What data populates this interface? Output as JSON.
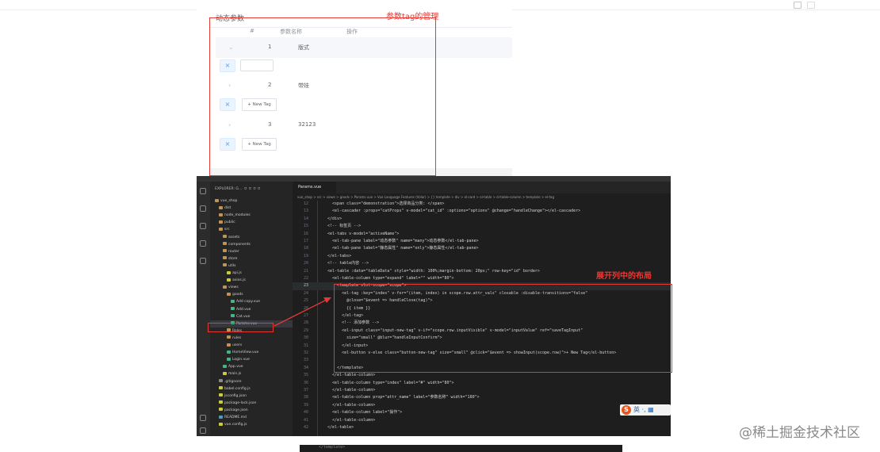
{
  "top_screenshot": {
    "title": "动态参数",
    "headers": [
      "#",
      "参数名称",
      "操作"
    ],
    "rows": [
      {
        "index": "1",
        "name": "版式",
        "expanded": true,
        "expand_icon": "chevron-down-icon"
      },
      {
        "index": "2",
        "name": "带娃",
        "expanded": false,
        "expand_icon": "chevron-right-icon"
      },
      {
        "index": "3",
        "name": "32123",
        "expanded": false,
        "expand_icon": "chevron-right-icon"
      }
    ],
    "new_tag_label": "+ New Tag",
    "tag_close": "×",
    "annotation": "参数tag的管理"
  },
  "editor": {
    "tab_label": "Params.vue",
    "explorer_title": "EXPLORER: G...",
    "breadcrumb": "vue_shop > src > views > goods > Params.vue > Vue Language Features (Volar) > {} template > div > el-card > el-table > el-table-column > template > el-tag",
    "explorer_items": [
      {
        "label": "vue_shop",
        "level": 0,
        "icon": "folder-open-icon"
      },
      {
        "label": "dist",
        "level": 1,
        "icon": "folder-icon"
      },
      {
        "label": "node_modules",
        "level": 1,
        "icon": "folder-icon"
      },
      {
        "label": "public",
        "level": 1,
        "icon": "folder-icon"
      },
      {
        "label": "src",
        "level": 1,
        "icon": "folder-open-icon"
      },
      {
        "label": "assets",
        "level": 2,
        "icon": "folder-icon"
      },
      {
        "label": "components",
        "level": 2,
        "icon": "folder-icon"
      },
      {
        "label": "router",
        "level": 2,
        "icon": "folder-icon"
      },
      {
        "label": "store",
        "level": 2,
        "icon": "folder-icon"
      },
      {
        "label": "utils",
        "level": 2,
        "icon": "folder-open-icon"
      },
      {
        "label": "api.js",
        "level": 3,
        "icon": "js-file-icon"
      },
      {
        "label": "axios.js",
        "level": 3,
        "icon": "js-file-icon"
      },
      {
        "label": "views",
        "level": 2,
        "icon": "folder-open-icon"
      },
      {
        "label": "goods",
        "level": 3,
        "icon": "folder-open-icon"
      },
      {
        "label": "Add copy.vue",
        "level": 4,
        "icon": "vue-file-icon"
      },
      {
        "label": "Add.vue",
        "level": 4,
        "icon": "vue-file-icon"
      },
      {
        "label": "Cat.vue",
        "level": 4,
        "icon": "vue-file-icon"
      },
      {
        "label": "Params.vue",
        "level": 4,
        "icon": "vue-file-icon",
        "selected": true
      },
      {
        "label": "Roles",
        "level": 3,
        "icon": "folder-icon"
      },
      {
        "label": "rules",
        "level": 3,
        "icon": "folder-icon"
      },
      {
        "label": "users",
        "level": 3,
        "icon": "folder-icon"
      },
      {
        "label": "HomeView.vue",
        "level": 3,
        "icon": "vue-file-icon"
      },
      {
        "label": "Login.vue",
        "level": 3,
        "icon": "vue-file-icon"
      },
      {
        "label": "App.vue",
        "level": 2,
        "icon": "vue-file-icon"
      },
      {
        "label": "main.js",
        "level": 2,
        "icon": "js-file-icon"
      },
      {
        "label": ".gitignore",
        "level": 1,
        "icon": "file-icon"
      },
      {
        "label": "babel.config.js",
        "level": 1,
        "icon": "js-file-icon"
      },
      {
        "label": "jsconfig.json",
        "level": 1,
        "icon": "json-file-icon"
      },
      {
        "label": "package-lock.json",
        "level": 1,
        "icon": "json-file-icon"
      },
      {
        "label": "package.json",
        "level": 1,
        "icon": "json-file-icon"
      },
      {
        "label": "README.md",
        "level": 1,
        "icon": "md-file-icon"
      },
      {
        "label": "vue.config.js",
        "level": 1,
        "icon": "js-file-icon"
      }
    ],
    "current_line": "23",
    "lines": [
      {
        "n": "12",
        "t": "    <span class=\"demonstration\">选择商品分类: </span>"
      },
      {
        "n": "13",
        "t": "    <el-cascader :props=\"catProps\" v-model=\"cat_id\" :options=\"options\" @change=\"handleChange\"></el-cascader>"
      },
      {
        "n": "14",
        "t": "  </div>"
      },
      {
        "n": "15",
        "t": "  <!-- 标签页 -->"
      },
      {
        "n": "16",
        "t": "  <el-tabs v-model=\"activeName\">"
      },
      {
        "n": "17",
        "t": "    <el-tab-pane label=\"动态参数\" name=\"many\">动态参数</el-tab-pane>"
      },
      {
        "n": "18",
        "t": "    <el-tab-pane label=\"静态属性\" name=\"only\">静态属性</el-tab-pane>"
      },
      {
        "n": "19",
        "t": "  </el-tabs>"
      },
      {
        "n": "20",
        "t": "  <!-- table内容 -->"
      },
      {
        "n": "21",
        "t": "  <el-table :data=\"tableData\" style=\"width: 100%;margin-bottom: 20px;\" row-key=\"id\" border>"
      },
      {
        "n": "22",
        "t": "    <el-table-column type=\"expand\" label=\"\" width=\"80\">"
      },
      {
        "n": "23",
        "t": "      <template slot-scope=\"scope\">"
      },
      {
        "n": "24",
        "t": "        <el-tag :key=\"index\" v-for=\"(item, index) in scope.row.attr_vals\" closable :disable-transitions=\"false\""
      },
      {
        "n": "25",
        "t": "          @close=\"$event => handleClose(tag)\">"
      },
      {
        "n": "26",
        "t": "          {{ item }}"
      },
      {
        "n": "27",
        "t": "        </el-tag>"
      },
      {
        "n": "28",
        "t": "        <!-- 添加参数 -->"
      },
      {
        "n": "29",
        "t": "        <el-input class=\"input-new-tag\" v-if=\"scope.row.inputVisible\" v-model=\"inputValue\" ref=\"saveTagInput\""
      },
      {
        "n": "30",
        "t": "          size=\"small\" @blur=\"handleInputConfirm\">"
      },
      {
        "n": "31",
        "t": "        </el-input>"
      },
      {
        "n": "32",
        "t": "        <el-button v-else class=\"button-new-tag\" size=\"small\" @click=\"$event => showInput(scope.row)\">+ New Tag</el-button>"
      },
      {
        "n": "33",
        "t": ""
      },
      {
        "n": "34",
        "t": "      </template>"
      },
      {
        "n": "35",
        "t": "    </el-table-column>"
      },
      {
        "n": "36",
        "t": "    <el-table-column type=\"index\" label=\"#\" width=\"80\">"
      },
      {
        "n": "37",
        "t": "    </el-table-column>"
      },
      {
        "n": "38",
        "t": "    <el-table-column prop=\"attr_name\" label=\"参数名称\" width=\"180\">"
      },
      {
        "n": "39",
        "t": "    </el-table-column>"
      },
      {
        "n": "40",
        "t": "    <el-table-column label=\"操作\">"
      },
      {
        "n": "41",
        "t": "    </el-table-column>"
      },
      {
        "n": "42",
        "t": "  </el-table>"
      }
    ],
    "annotation": "展开列中的布局",
    "ime_text": "英 ·, ▦"
  },
  "bottom_strip": "</template>",
  "watermark": "@稀土掘金技术社区",
  "colors": {
    "annotation": "#e53935",
    "editor_bg": "#1e1e1e",
    "tag_blue": "#409eff"
  }
}
